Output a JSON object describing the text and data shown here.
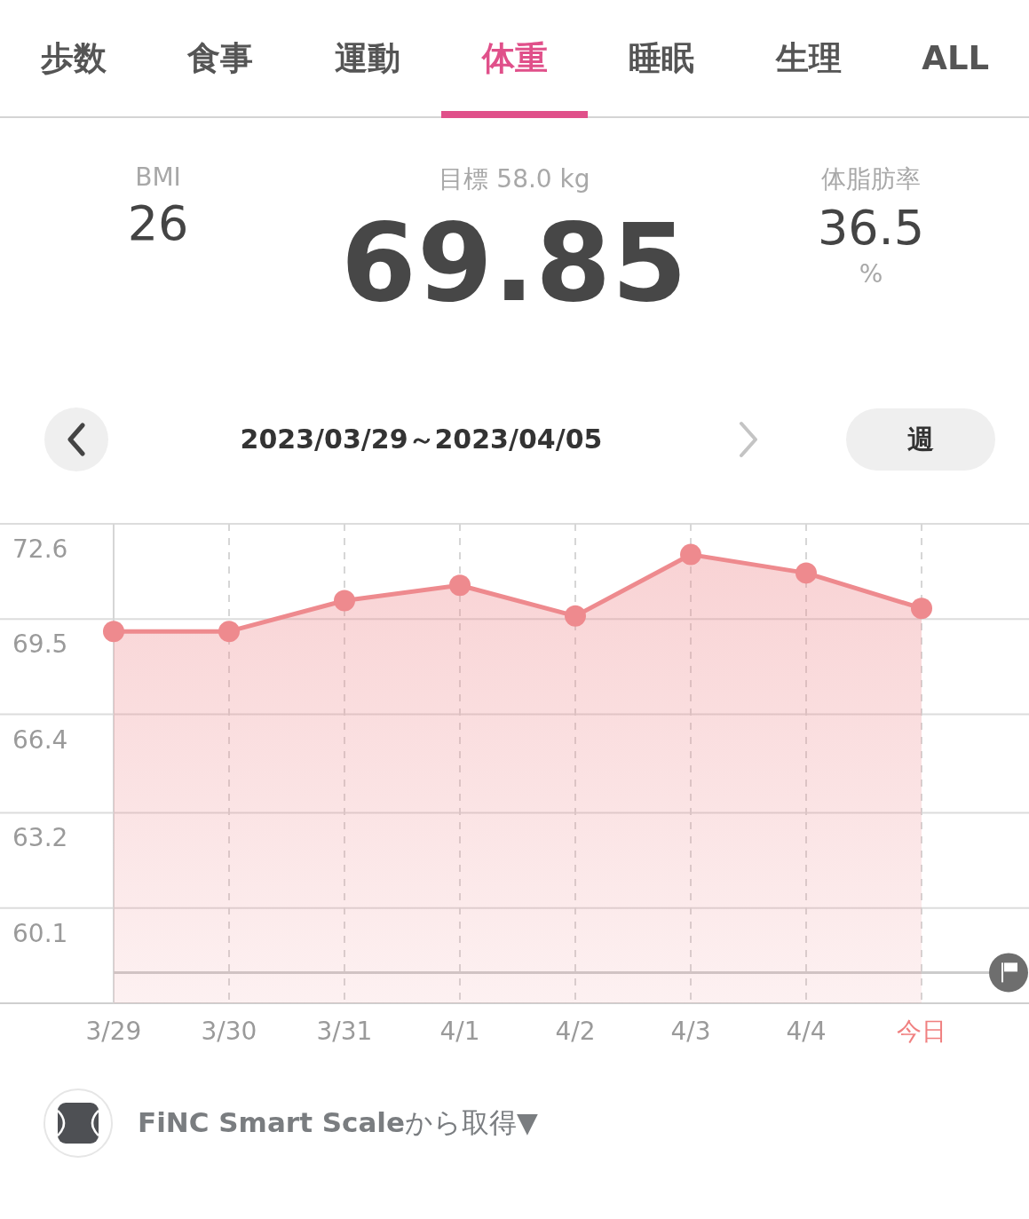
{
  "tabs": [
    {
      "label": "歩数",
      "selected": false
    },
    {
      "label": "食事",
      "selected": false
    },
    {
      "label": "運動",
      "selected": false
    },
    {
      "label": "体重",
      "selected": true
    },
    {
      "label": "睡眠",
      "selected": false
    },
    {
      "label": "生理",
      "selected": false
    },
    {
      "label": "ALL",
      "selected": false
    }
  ],
  "summary": {
    "bmi": {
      "label": "BMI",
      "value": "26"
    },
    "goal": "目標 58.0 kg",
    "weight": "69.85",
    "body_fat": {
      "label": "体脂肪率",
      "value": "36.5",
      "unit": "%"
    }
  },
  "date_nav": {
    "range": "2023/03/29～2023/04/05",
    "next_disabled": true,
    "period": "週"
  },
  "chart": {
    "chart_data": {
      "type": "area",
      "grid": true,
      "categories": [
        "3/29",
        "3/30",
        "3/31",
        "4/1",
        "4/2",
        "4/3",
        "4/4",
        "今日"
      ],
      "series": [
        {
          "color": "#ee8a8e",
          "values": [
            69.1,
            69.1,
            70.1,
            70.6,
            69.6,
            71.6,
            71.0,
            69.85
          ]
        }
      ],
      "ylim": [
        57.0,
        72.6
      ],
      "yticks": [
        72.6,
        69.5,
        66.4,
        63.2,
        60.1
      ],
      "ref_lines": [
        {
          "axis": "y",
          "value": 58.0
        }
      ]
    }
  },
  "source": {
    "text": "**FiNC Smart Scale**から取得▼"
  }
}
